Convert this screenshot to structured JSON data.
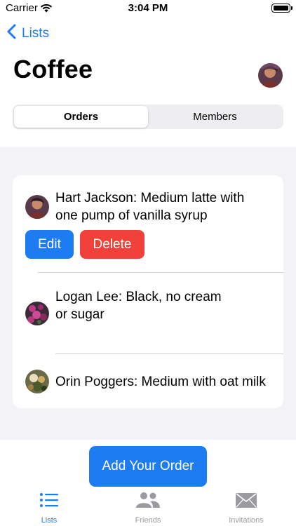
{
  "status_bar": {
    "carrier": "Carrier",
    "time": "3:04 PM"
  },
  "nav": {
    "back_label": "Lists",
    "title": "Coffee"
  },
  "segmented": {
    "orders": "Orders",
    "members": "Members",
    "selected": "Orders"
  },
  "orders": [
    {
      "text_line1": "Hart Jackson: Medium latte with",
      "text_line2": "one pump of vanilla syrup"
    },
    {
      "text_line1": "Logan Lee: Black, no cream",
      "text_line2": "or sugar"
    },
    {
      "text_line1": "Orin Poggers: Medium with oat milk",
      "text_line2": ""
    }
  ],
  "actions": {
    "edit": "Edit",
    "delete": "Delete"
  },
  "add_order_label": "Add Your Order",
  "tab_bar": [
    {
      "label": "Lists",
      "icon": "list-icon",
      "active": true
    },
    {
      "label": "Friends",
      "icon": "people-icon",
      "active": false
    },
    {
      "label": "Invitations",
      "icon": "envelope-icon",
      "active": false
    }
  ],
  "colors": {
    "accent": "#1e7cf2",
    "destructive": "#f2403a",
    "grouped_background": "#f2f2f7"
  }
}
